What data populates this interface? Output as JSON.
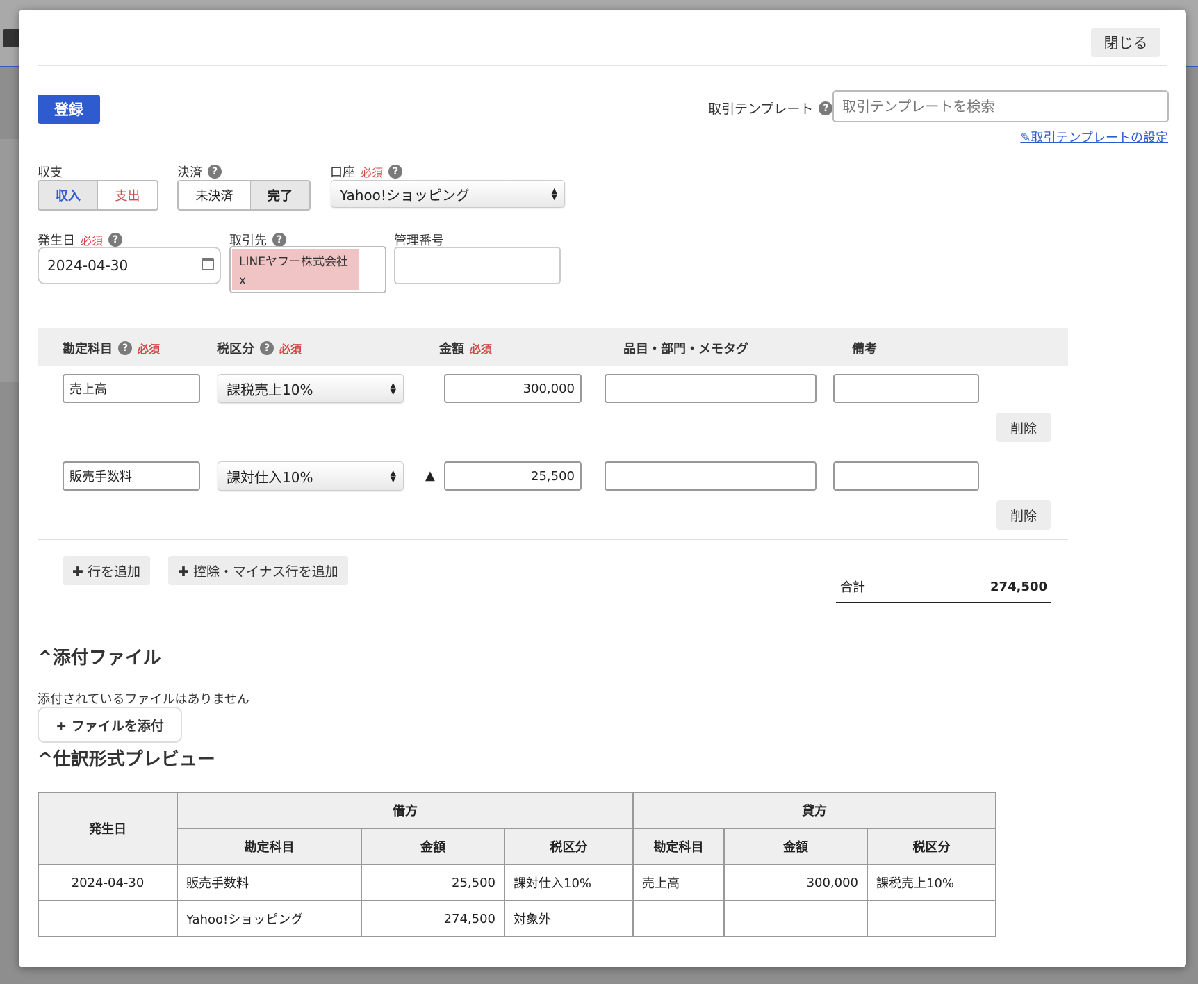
{
  "modal": {
    "close_label": "閉じる",
    "register_label": "登録",
    "template": {
      "label": "取引テンプレート",
      "placeholder": "取引テンプレートを検索",
      "settings_link": "取引テンプレートの設定"
    },
    "required_text": "必須",
    "help_text": "?",
    "income_expense": {
      "label": "収支",
      "options": [
        "収入",
        "支出"
      ],
      "selected": "収入"
    },
    "settlement": {
      "label": "決済",
      "options": [
        "未決済",
        "完了"
      ],
      "selected": "完了"
    },
    "account": {
      "label": "口座",
      "value": "Yahoo!ショッピング"
    },
    "date": {
      "label": "発生日",
      "value": "2024-04-30"
    },
    "partner": {
      "label": "取引先",
      "tag": "LINEヤフー株式会社",
      "remove": "x"
    },
    "control_no": {
      "label": "管理番号",
      "value": ""
    },
    "line_headers": {
      "account": "勘定科目",
      "tax": "税区分",
      "amount": "金額",
      "tags": "品目・部門・メモタグ",
      "note": "備考"
    },
    "lines": [
      {
        "account": "売上高",
        "tax": "課税売上10%",
        "amount": "300,000",
        "sign": "",
        "tags": "",
        "note": "",
        "delete_label": "削除"
      },
      {
        "account": "販売手数料",
        "tax": "課対仕入10%",
        "amount": "25,500",
        "sign": "▲",
        "tags": "",
        "note": "",
        "delete_label": "削除"
      }
    ],
    "add_row_label": "行を追加",
    "add_minus_row_label": "控除・マイナス行を追加",
    "total": {
      "label": "合計",
      "value": "274,500"
    },
    "attachments": {
      "title": "添付ファイル",
      "empty_text": "添付されているファイルはありません",
      "add_label": "ファイルを添付"
    },
    "preview": {
      "title": "仕訳形式プレビュー",
      "headers": {
        "date": "発生日",
        "debit": "借方",
        "credit": "貸方",
        "account": "勘定科目",
        "amount": "金額",
        "tax": "税区分"
      },
      "rows": [
        {
          "date": "2024-04-30",
          "debit_account": "販売手数料",
          "debit_amount": "25,500",
          "debit_tax": "課対仕入10%",
          "credit_account": "売上高",
          "credit_amount": "300,000",
          "credit_tax": "課税売上10%"
        },
        {
          "date": "",
          "debit_account": "Yahoo!ショッピング",
          "debit_amount": "274,500",
          "debit_tax": "対象外",
          "credit_account": "",
          "credit_amount": "",
          "credit_tax": ""
        }
      ]
    }
  }
}
